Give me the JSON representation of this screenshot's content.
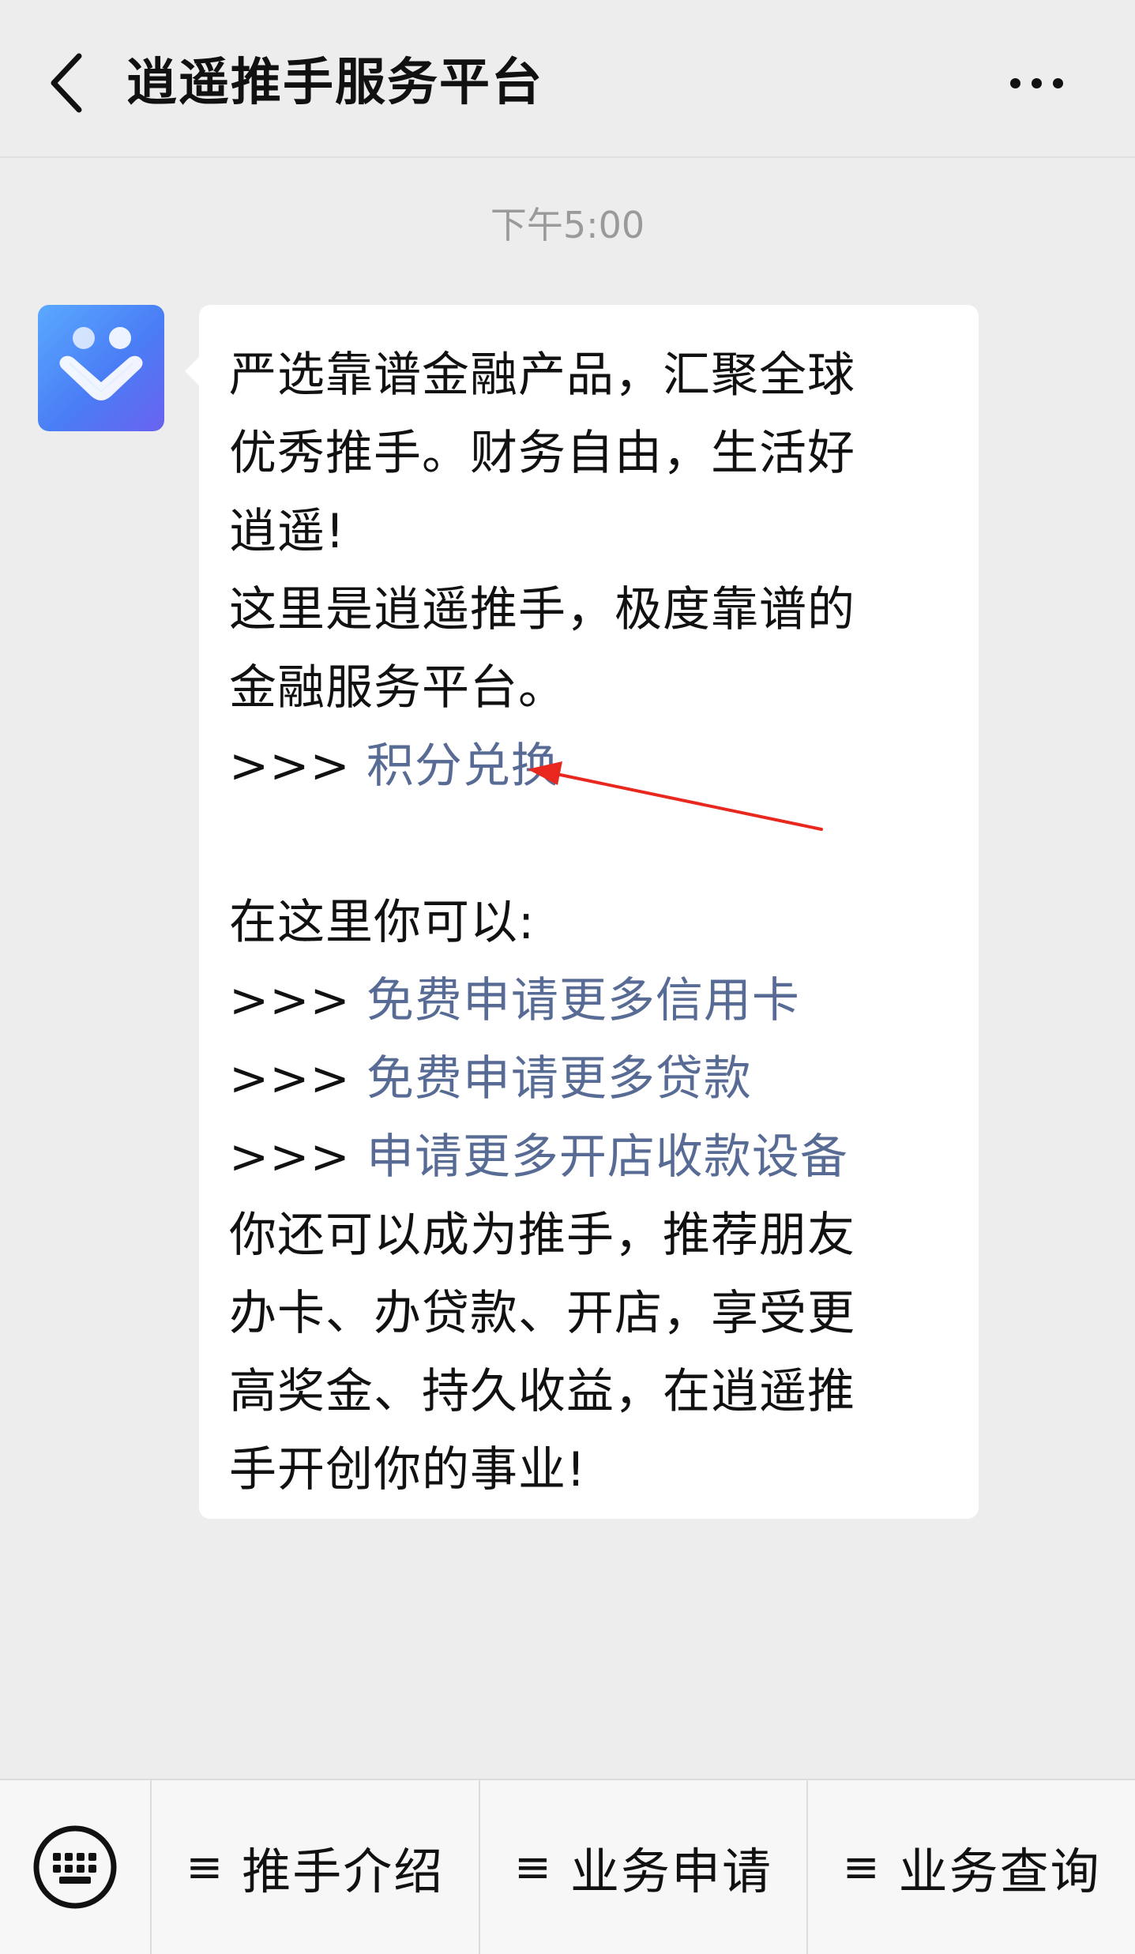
{
  "header": {
    "title": "逍遥推手服务平台",
    "back_icon": "chevron-left-icon",
    "more_icon": "more-dots-icon"
  },
  "chat": {
    "timestamp": "下午5:00",
    "avatar_icon": "brand-logo-icon",
    "message": {
      "lines": [
        {
          "text": "严选靠谱金融产品，汇聚全球"
        },
        {
          "text": "优秀推手。财务自由，生活好"
        },
        {
          "text": "逍遥!"
        },
        {
          "text": "这里是逍遥推手，极度靠谱的"
        },
        {
          "text": "金融服务平台。"
        }
      ],
      "link_prefix": ">>> ",
      "points_link": "积分兑换",
      "intro": "在这里你可以:",
      "links": [
        "免费申请更多信用卡",
        "免费申请更多贷款",
        "申请更多开店收款设备"
      ],
      "closing_lines": [
        "你还可以成为推手，推荐朋友",
        "办卡、办贷款、开店，享受更",
        "高奖金、持久收益，在逍遥推",
        "手开创你的事业!"
      ]
    },
    "annotation_color": "#e8281e"
  },
  "menu": {
    "keyboard_icon": "keyboard-icon",
    "items": [
      {
        "label": "推手介绍"
      },
      {
        "label": "业务申请"
      },
      {
        "label": "业务查询"
      }
    ]
  }
}
